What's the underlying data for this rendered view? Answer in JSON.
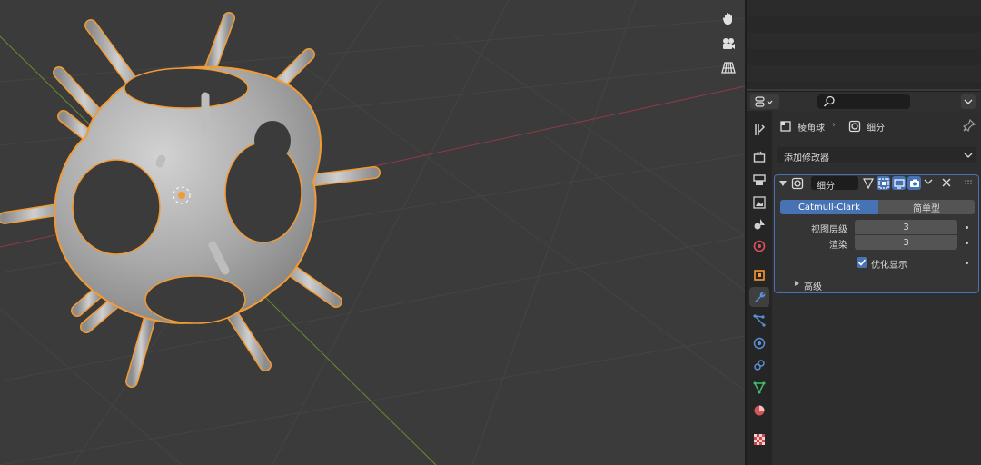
{
  "properties": {
    "breadcrumb": {
      "object_name": "棱角球",
      "separator": "›",
      "modifier_name": "细分"
    },
    "add_modifier_label": "添加修改器",
    "modifier": {
      "name": "细分",
      "mode_tabs": [
        {
          "label": "Catmull-Clark",
          "active": true
        },
        {
          "label": "简单型",
          "active": false
        }
      ],
      "viewport_levels_label": "视图层级",
      "viewport_levels_value": "3",
      "render_label": "渲染",
      "render_value": "3",
      "optimal_display_label": "优化显示",
      "optimal_display_checked": true,
      "advanced_label": "高级"
    },
    "search_placeholder": ""
  },
  "viewport": {
    "nav_icons": [
      "hand-pan-icon",
      "camera-icon",
      "grid-perspective-icon"
    ]
  },
  "properties_tabs": [
    "tool-icon",
    "render-icon",
    "output-icon",
    "view-layer-icon",
    "scene-icon",
    "world-icon",
    "object-icon",
    "modifier-wrench-icon",
    "particles-icon",
    "physics-icon",
    "constraints-icon",
    "object-data-icon",
    "material-icon",
    "texture-icon"
  ],
  "colors": {
    "accent_blue": "#4772b3",
    "selection_orange": "#f39a33",
    "x_axis": "#8f3b46",
    "y_axis": "#6a8a32"
  }
}
